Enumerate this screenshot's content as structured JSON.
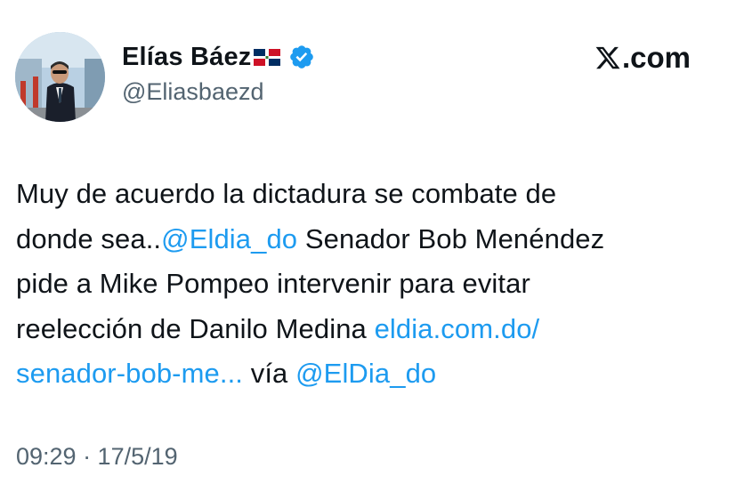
{
  "author": {
    "display_name": "Elías Báez",
    "flag_icon": "dominican-republic-flag-icon",
    "verified_icon": "verified-badge-icon",
    "handle": "@Eliasbaezd"
  },
  "brand": {
    "logo_icon": "x-logo-icon",
    "label": ".com"
  },
  "tweet": {
    "line1": "Muy de acuerdo la dictadura se combate de",
    "line2_pre": "donde sea..",
    "line2_mention": "@Eldia_do",
    "line2_post": " Senador Bob Menéndez",
    "line3": "pide a Mike Pompeo intervenir para evitar",
    "line4_pre": "reelección de Danilo Medina ",
    "line4_link": "eldia.com.do/",
    "line5_link": "senador-bob-me...",
    "line5_mid": " vía ",
    "line5_mention": "@ElDia_do"
  },
  "timestamp": "09:29 · 17/5/19",
  "colors": {
    "link": "#1d9bf0",
    "verified": "#1d9bf0",
    "secondary_text": "#536471",
    "primary_text": "#0f1419"
  }
}
